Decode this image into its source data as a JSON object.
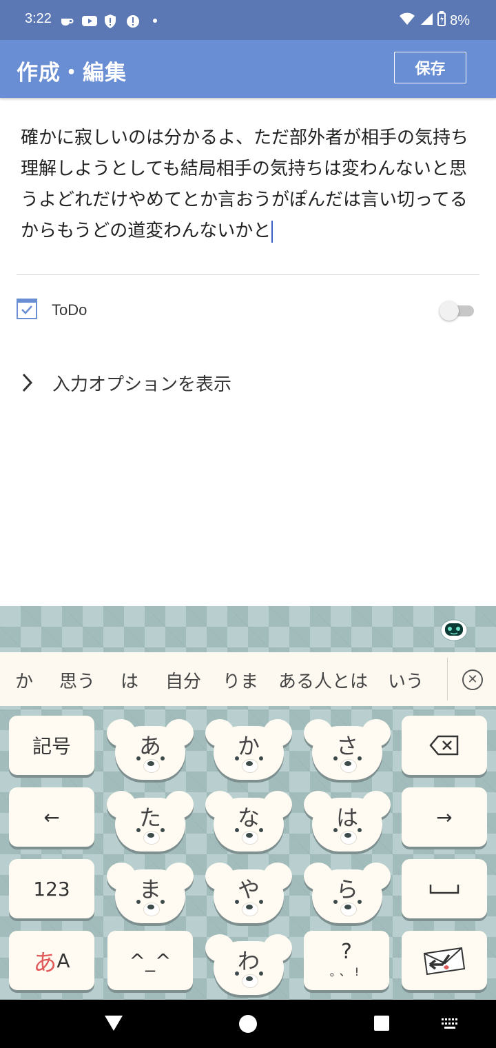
{
  "status_bar": {
    "time": "3:22",
    "battery": "8%",
    "icons_left": [
      "coffee-icon",
      "youtube-icon",
      "shield-alert-icon",
      "alert-circle-icon",
      "dot-icon"
    ],
    "icons_right": [
      "wifi-icon",
      "signal-icon",
      "battery-charging-icon"
    ]
  },
  "app_bar": {
    "title": "作成・編集",
    "save_label": "保存",
    "background": "#6a8ed4"
  },
  "memo": {
    "text": "確かに寂しいのは分かるよ、ただ部外者が相手の気持ち理解しようとしても結局相手の気持ちは変わんないと思うよどれだけやめてとか言おうがぽんだは言い切ってるからもうどの道変わんないかと"
  },
  "todo": {
    "label": "ToDo",
    "checked": true,
    "toggle_on": false
  },
  "input_options": {
    "label": "入力オプションを表示"
  },
  "keyboard": {
    "candidates": [
      "か",
      "思う",
      "は",
      "自分",
      "りま",
      "ある人とは",
      "いう"
    ],
    "keys": {
      "symbols": "記号",
      "left_arrow": "←",
      "right_arrow": "→",
      "numbers": "123",
      "mode_a": "あ",
      "mode_b": "A",
      "emoticon": "^_^",
      "punct_q": "?",
      "punct_small": "。、!",
      "kana": [
        "あ",
        "か",
        "さ",
        "た",
        "な",
        "は",
        "ま",
        "や",
        "ら",
        "わ"
      ]
    },
    "colors": {
      "key": "#fffaf2",
      "background": "#b9cfcf",
      "accent_red": "#e05a5a"
    }
  }
}
